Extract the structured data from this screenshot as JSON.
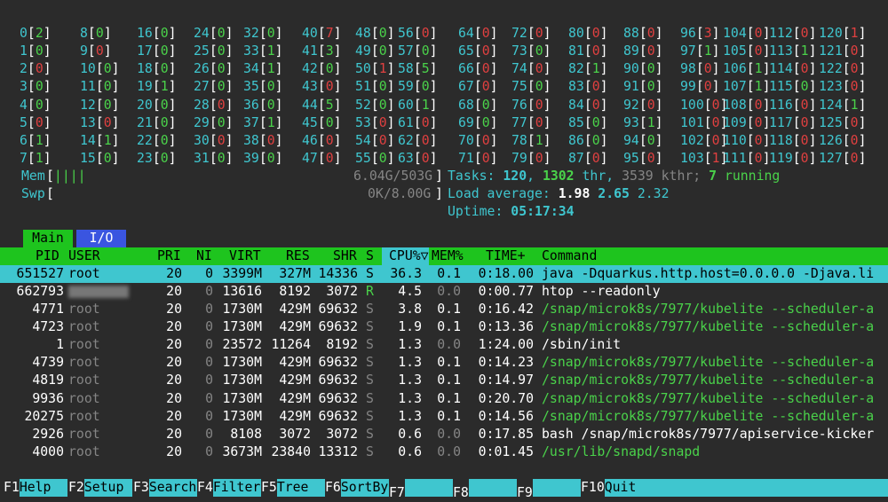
{
  "cpus": [
    {
      "id": "0",
      "v": "2"
    },
    {
      "id": "1",
      "v": "0"
    },
    {
      "id": "2",
      "v": "0"
    },
    {
      "id": "3",
      "v": "0"
    },
    {
      "id": "4",
      "v": "0"
    },
    {
      "id": "5",
      "v": "0"
    },
    {
      "id": "6",
      "v": "1"
    },
    {
      "id": "7",
      "v": "1"
    },
    {
      "id": "8",
      "v": "0"
    },
    {
      "id": "9",
      "v": "0"
    },
    {
      "id": "10",
      "v": "0"
    },
    {
      "id": "11",
      "v": "0"
    },
    {
      "id": "12",
      "v": "0"
    },
    {
      "id": "13",
      "v": "0"
    },
    {
      "id": "14",
      "v": "1"
    },
    {
      "id": "15",
      "v": "0"
    },
    {
      "id": "16",
      "v": "0"
    },
    {
      "id": "17",
      "v": "0"
    },
    {
      "id": "18",
      "v": "0"
    },
    {
      "id": "19",
      "v": "1"
    },
    {
      "id": "20",
      "v": "0"
    },
    {
      "id": "21",
      "v": "0"
    },
    {
      "id": "22",
      "v": "0"
    },
    {
      "id": "23",
      "v": "0"
    },
    {
      "id": "24",
      "v": "0"
    },
    {
      "id": "25",
      "v": "0"
    },
    {
      "id": "26",
      "v": "0"
    },
    {
      "id": "27",
      "v": "0"
    },
    {
      "id": "28",
      "v": "0"
    },
    {
      "id": "29",
      "v": "0"
    },
    {
      "id": "30",
      "v": "0"
    },
    {
      "id": "31",
      "v": "0"
    },
    {
      "id": "32",
      "v": "0"
    },
    {
      "id": "33",
      "v": "1"
    },
    {
      "id": "34",
      "v": "1"
    },
    {
      "id": "35",
      "v": "0"
    },
    {
      "id": "36",
      "v": "0"
    },
    {
      "id": "37",
      "v": "1"
    },
    {
      "id": "38",
      "v": "0"
    },
    {
      "id": "39",
      "v": "0"
    },
    {
      "id": "40",
      "v": "7"
    },
    {
      "id": "41",
      "v": "3"
    },
    {
      "id": "42",
      "v": "0"
    },
    {
      "id": "43",
      "v": "0"
    },
    {
      "id": "44",
      "v": "5"
    },
    {
      "id": "45",
      "v": "0"
    },
    {
      "id": "46",
      "v": "0"
    },
    {
      "id": "47",
      "v": "0"
    },
    {
      "id": "48",
      "v": "0"
    },
    {
      "id": "49",
      "v": "0"
    },
    {
      "id": "50",
      "v": "1"
    },
    {
      "id": "51",
      "v": "0"
    },
    {
      "id": "52",
      "v": "0"
    },
    {
      "id": "53",
      "v": "0"
    },
    {
      "id": "54",
      "v": "0"
    },
    {
      "id": "55",
      "v": "0"
    },
    {
      "id": "56",
      "v": "0"
    },
    {
      "id": "57",
      "v": "0"
    },
    {
      "id": "58",
      "v": "5"
    },
    {
      "id": "59",
      "v": "0"
    },
    {
      "id": "60",
      "v": "1"
    },
    {
      "id": "61",
      "v": "0"
    },
    {
      "id": "62",
      "v": "0"
    },
    {
      "id": "63",
      "v": "0"
    },
    {
      "id": "64",
      "v": "0"
    },
    {
      "id": "65",
      "v": "0"
    },
    {
      "id": "66",
      "v": "0"
    },
    {
      "id": "67",
      "v": "0"
    },
    {
      "id": "68",
      "v": "0"
    },
    {
      "id": "69",
      "v": "0"
    },
    {
      "id": "70",
      "v": "0"
    },
    {
      "id": "71",
      "v": "0"
    },
    {
      "id": "72",
      "v": "0"
    },
    {
      "id": "73",
      "v": "0"
    },
    {
      "id": "74",
      "v": "0"
    },
    {
      "id": "75",
      "v": "0"
    },
    {
      "id": "76",
      "v": "0"
    },
    {
      "id": "77",
      "v": "0"
    },
    {
      "id": "78",
      "v": "1"
    },
    {
      "id": "79",
      "v": "0"
    },
    {
      "id": "80",
      "v": "0"
    },
    {
      "id": "81",
      "v": "0"
    },
    {
      "id": "82",
      "v": "1"
    },
    {
      "id": "83",
      "v": "0"
    },
    {
      "id": "84",
      "v": "0"
    },
    {
      "id": "85",
      "v": "0"
    },
    {
      "id": "86",
      "v": "0"
    },
    {
      "id": "87",
      "v": "0"
    },
    {
      "id": "88",
      "v": "0"
    },
    {
      "id": "89",
      "v": "0"
    },
    {
      "id": "90",
      "v": "0"
    },
    {
      "id": "91",
      "v": "0"
    },
    {
      "id": "92",
      "v": "0"
    },
    {
      "id": "93",
      "v": "1"
    },
    {
      "id": "94",
      "v": "0"
    },
    {
      "id": "95",
      "v": "0"
    },
    {
      "id": "96",
      "v": "3"
    },
    {
      "id": "97",
      "v": "1"
    },
    {
      "id": "98",
      "v": "0"
    },
    {
      "id": "99",
      "v": "0"
    },
    {
      "id": "100",
      "v": "0"
    },
    {
      "id": "101",
      "v": "0"
    },
    {
      "id": "102",
      "v": "0"
    },
    {
      "id": "103",
      "v": "1"
    },
    {
      "id": "104",
      "v": "0"
    },
    {
      "id": "105",
      "v": "0"
    },
    {
      "id": "106",
      "v": "1"
    },
    {
      "id": "107",
      "v": "1"
    },
    {
      "id": "108",
      "v": "0"
    },
    {
      "id": "109",
      "v": "0"
    },
    {
      "id": "110",
      "v": "0"
    },
    {
      "id": "111",
      "v": "0"
    },
    {
      "id": "112",
      "v": "0"
    },
    {
      "id": "113",
      "v": "1"
    },
    {
      "id": "114",
      "v": "0"
    },
    {
      "id": "115",
      "v": "0"
    },
    {
      "id": "116",
      "v": "0"
    },
    {
      "id": "117",
      "v": "0"
    },
    {
      "id": "118",
      "v": "0"
    },
    {
      "id": "119",
      "v": "0"
    },
    {
      "id": "120",
      "v": "1"
    },
    {
      "id": "121",
      "v": "0"
    },
    {
      "id": "122",
      "v": "0"
    },
    {
      "id": "123",
      "v": "0"
    },
    {
      "id": "124",
      "v": "1"
    },
    {
      "id": "125",
      "v": "0"
    },
    {
      "id": "126",
      "v": "0"
    },
    {
      "id": "127",
      "v": "0"
    }
  ],
  "meters": {
    "mem_label": "Mem",
    "mem_bar": "||||",
    "mem_value": "6.04G/503G",
    "swp_label": "Swp",
    "swp_value": "0K/8.00G"
  },
  "summary": {
    "tasks_label": "Tasks:",
    "tasks": "120",
    "thr": "1302",
    "thr_label": "thr,",
    "kthr": "3539",
    "kthr_label": "kthr;",
    "running": "7",
    "running_label": "running",
    "load_label": "Load average:",
    "load1": "1.98",
    "load5": "2.65",
    "load15": "2.32",
    "uptime_label": "Uptime:",
    "uptime": "05:17:34"
  },
  "tabs": {
    "main": "Main",
    "io": "I/O"
  },
  "headers": {
    "pid": "PID",
    "user": "USER",
    "pri": "PRI",
    "ni": "NI",
    "virt": "VIRT",
    "res": "RES",
    "shr": "SHR",
    "s": "S",
    "cpu": "CPU%▽",
    "mem": "MEM%",
    "time": "TIME+",
    "command": "Command"
  },
  "processes": [
    {
      "pid": "651527",
      "user": "root",
      "pri": "20",
      "ni": "0",
      "virt": "3399M",
      "res": "327M",
      "shr": "14336",
      "s": "S",
      "cpu": "36.3",
      "mem": "0.1",
      "time": "0:18.00",
      "command": "java -Dquarkus.http.host=0.0.0.0 -Djava.li"
    },
    {
      "pid": "662793",
      "user": "",
      "pri": "20",
      "ni": "0",
      "virt": "13616",
      "res": "8192",
      "shr": "3072",
      "s": "R",
      "cpu": "4.5",
      "mem": "0.0",
      "time": "0:00.77",
      "command": "htop --readonly"
    },
    {
      "pid": "4771",
      "user": "root",
      "pri": "20",
      "ni": "0",
      "virt": "1730M",
      "res": "429M",
      "shr": "69632",
      "s": "S",
      "cpu": "3.8",
      "mem": "0.1",
      "time": "0:16.42",
      "command": "/snap/microk8s/7977/kubelite --scheduler-a"
    },
    {
      "pid": "4723",
      "user": "root",
      "pri": "20",
      "ni": "0",
      "virt": "1730M",
      "res": "429M",
      "shr": "69632",
      "s": "S",
      "cpu": "1.9",
      "mem": "0.1",
      "time": "0:13.36",
      "command": "/snap/microk8s/7977/kubelite --scheduler-a"
    },
    {
      "pid": "1",
      "user": "root",
      "pri": "20",
      "ni": "0",
      "virt": "23572",
      "res": "11264",
      "shr": "8192",
      "s": "S",
      "cpu": "1.3",
      "mem": "0.0",
      "time": "1:24.00",
      "command": "/sbin/init"
    },
    {
      "pid": "4739",
      "user": "root",
      "pri": "20",
      "ni": "0",
      "virt": "1730M",
      "res": "429M",
      "shr": "69632",
      "s": "S",
      "cpu": "1.3",
      "mem": "0.1",
      "time": "0:14.23",
      "command": "/snap/microk8s/7977/kubelite --scheduler-a"
    },
    {
      "pid": "4819",
      "user": "root",
      "pri": "20",
      "ni": "0",
      "virt": "1730M",
      "res": "429M",
      "shr": "69632",
      "s": "S",
      "cpu": "1.3",
      "mem": "0.1",
      "time": "0:14.97",
      "command": "/snap/microk8s/7977/kubelite --scheduler-a"
    },
    {
      "pid": "9936",
      "user": "root",
      "pri": "20",
      "ni": "0",
      "virt": "1730M",
      "res": "429M",
      "shr": "69632",
      "s": "S",
      "cpu": "1.3",
      "mem": "0.1",
      "time": "0:20.70",
      "command": "/snap/microk8s/7977/kubelite --scheduler-a"
    },
    {
      "pid": "20275",
      "user": "root",
      "pri": "20",
      "ni": "0",
      "virt": "1730M",
      "res": "429M",
      "shr": "69632",
      "s": "S",
      "cpu": "1.3",
      "mem": "0.1",
      "time": "0:14.56",
      "command": "/snap/microk8s/7977/kubelite --scheduler-a"
    },
    {
      "pid": "2926",
      "user": "root",
      "pri": "20",
      "ni": "0",
      "virt": "8108",
      "res": "3072",
      "shr": "3072",
      "s": "S",
      "cpu": "0.6",
      "mem": "0.0",
      "time": "0:17.85",
      "command": "bash /snap/microk8s/7977/apiservice-kicker"
    },
    {
      "pid": "4000",
      "user": "root",
      "pri": "20",
      "ni": "0",
      "virt": "3673M",
      "res": "23840",
      "shr": "13312",
      "s": "S",
      "cpu": "0.6",
      "mem": "0.0",
      "time": "0:01.45",
      "command": "/usr/lib/snapd/snapd"
    }
  ],
  "fkeys": [
    {
      "key": "F1",
      "label": "Help"
    },
    {
      "key": "F2",
      "label": "Setup"
    },
    {
      "key": "F3",
      "label": "Search"
    },
    {
      "key": "F4",
      "label": "Filter"
    },
    {
      "key": "F5",
      "label": "Tree"
    },
    {
      "key": "F6",
      "label": "SortBy"
    },
    {
      "key": "F7",
      "label": ""
    },
    {
      "key": "F8",
      "label": ""
    },
    {
      "key": "F9",
      "label": ""
    },
    {
      "key": "F10",
      "label": "Quit"
    }
  ],
  "colors": {
    "background": "#2b2b2b",
    "cyan": "#3fc6cf",
    "green": "#4ad24a",
    "red": "#e04040",
    "header_green": "#1ec41e",
    "io_tab_blue": "#3a55e0",
    "selected_row": "#3fc6cf"
  }
}
